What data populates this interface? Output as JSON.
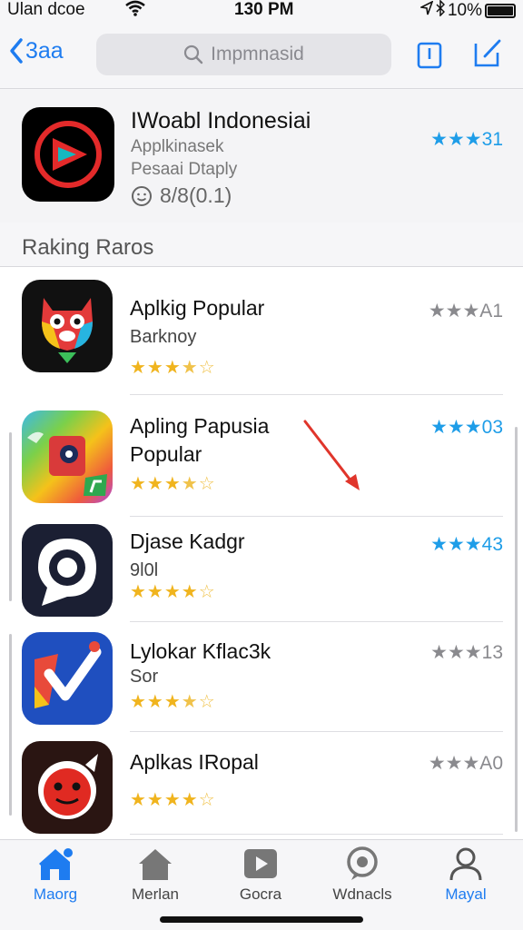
{
  "status": {
    "carrier": "Ulan dcoe",
    "time": "130 PM",
    "battery": "10%"
  },
  "nav": {
    "back_label": "3aa",
    "search_placeholder": "Impmnasid"
  },
  "featured": {
    "title": "IWoabl Indonesiai",
    "subtitle1": "Applkinasek",
    "subtitle2": "Pesaai Dtaply",
    "rating": "8/8(0.1)",
    "score": "★★★31"
  },
  "section_title": "Raking Raros",
  "apps": [
    {
      "name": "Aplkig Popular",
      "sub": "Barknoy",
      "stars": "★★★",
      "stars_empty": "★☆",
      "score": "★★★A1",
      "score_color": "#8a8a8e"
    },
    {
      "name": "Apling Papusia",
      "name2": "Popular",
      "sub": "",
      "stars": "★★★",
      "stars_empty": "★☆",
      "score": "★★★03",
      "score_color": "#1e9de8"
    },
    {
      "name": "Djase Kadgr",
      "sub": "9l0l",
      "stars": "★★★★",
      "stars_empty": "☆",
      "score": "★★★43",
      "score_color": "#1e9de8"
    },
    {
      "name": "Lylokar Kflac3k",
      "sub": "Sor",
      "stars": "★★★",
      "stars_empty": "★☆",
      "score": "★★★13",
      "score_color": "#8a8a8e"
    },
    {
      "name": "Aplkas IRopal",
      "sub": "",
      "stars": "★★★★",
      "stars_empty": "☆",
      "score": "★★★A0",
      "score_color": "#8a8a8e"
    }
  ],
  "tabs": [
    {
      "label": "Maorg",
      "active": true
    },
    {
      "label": "Merlan",
      "active": false
    },
    {
      "label": "Gocra",
      "active": false
    },
    {
      "label": "Wdnacls",
      "active": false
    },
    {
      "label": "Mayal",
      "active": true
    }
  ],
  "colors": {
    "accent": "#1e7cf0",
    "star_blue": "#1e9de8",
    "star_gold": "#f0b41e",
    "star_gray": "#8a8a8e"
  }
}
